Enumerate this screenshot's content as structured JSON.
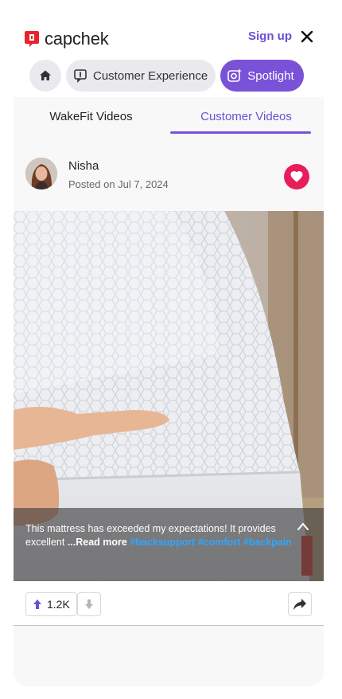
{
  "header": {
    "logo_text": "capchek",
    "signup_label": "Sign up",
    "close_icon": "close-icon",
    "brand_color": "#e8232e",
    "accent_color": "#7a52d8"
  },
  "nav": {
    "home_icon": "home-icon",
    "chips": [
      {
        "label": "Customer Experience",
        "icon": "chat-badge-icon",
        "active": false
      },
      {
        "label": "Spotlight",
        "icon": "sparkle-camera-icon",
        "active": true
      }
    ]
  },
  "tabs": [
    {
      "label": "WakeFit Videos",
      "active": false
    },
    {
      "label": "Customer Videos",
      "active": true
    }
  ],
  "post": {
    "author": "Nisha",
    "posted": "Posted on Jul 7, 2024",
    "liked": true,
    "caption_text": "This mattress has exceeded my expectations! It provides excellent",
    "read_more": "...Read more",
    "hashtags": [
      "#backsupport",
      "#comfort",
      "#backpain"
    ],
    "upvotes": "1.2K"
  }
}
